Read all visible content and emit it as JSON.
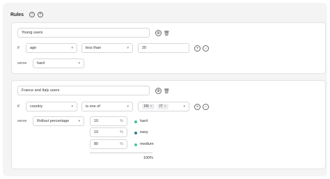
{
  "header": {
    "title": "Rules",
    "info_icon": "info-icon",
    "add_icon": "plus-circle-icon"
  },
  "rules": [
    {
      "name": "Young users",
      "if_label": "if",
      "attribute": "age",
      "operator": "less than",
      "value": "20",
      "serve_label": "serve",
      "serve": "hard"
    },
    {
      "name": "France and Italy users",
      "if_label": "if",
      "attribute": "country",
      "operator": "is one of",
      "tags": [
        "FR",
        "IT"
      ],
      "serve_label": "serve",
      "serve": "Rollout percentage",
      "rollout": [
        {
          "percent": "10",
          "unit": "%",
          "variation": "hard",
          "color": "#3fc28a"
        },
        {
          "percent": "10",
          "unit": "%",
          "variation": "easy",
          "color": "#2a7f8f"
        },
        {
          "percent": "80",
          "unit": "%",
          "variation": "medium",
          "color": "#47c98f"
        }
      ],
      "total": "100%"
    }
  ]
}
